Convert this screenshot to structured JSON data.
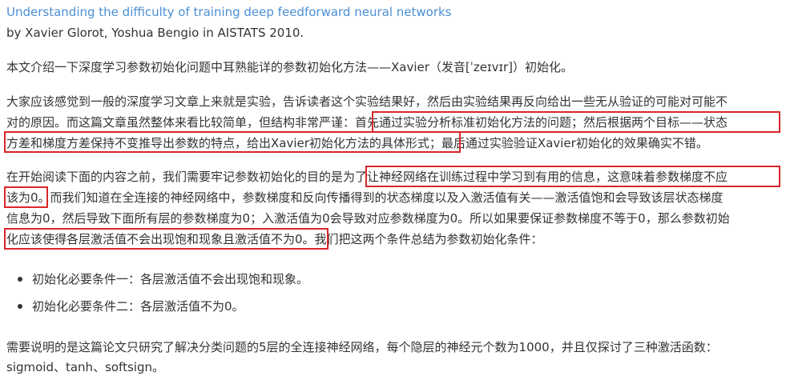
{
  "paper": {
    "title": "Understanding the difficulty of training deep feedforward neural networks",
    "byline": "by Xavier Glorot, Yoshua Bengio in AISTATS 2010."
  },
  "intro": "本文介绍一下深度学习参数初始化问题中耳熟能详的参数初始化方法——Xavier（发音[ˈzeɪvɪr]）初始化。",
  "para1": {
    "line1": "大家应该感觉到一般的深度学习文章上来就是实验，告诉读者这个实验结果好，然后由实验结果再反向给出一些无从验证的可能对可能不",
    "line2a": "对的原因。而这篇文章虽然整体来看比较简单，但结构非常严谨：",
    "line2b": "首先通过实验分析标准初始化方法的问题；然后根据两个目标——状态",
    "line3a": "方差和梯度方差保持不变推导出参数的特点，给出Xavier初始化方法的具体形式；",
    "line3b": "最后通过实验验证Xavier初始化的效果确实不错。"
  },
  "para2": {
    "line1a": "在开始阅读下面的内容之前，我们需要牢记参数初始化的目的是",
    "line1b": "为了让神经网络在训练过程中学习到有用的信息，这意味着参数梯度不应",
    "line2a": "该为0。",
    "line2b": "而我们知道在全连接的神经网络中，参数梯度和反向传播得到的状态梯度以及入激活值有关——激活值饱和会导致该层状态梯度",
    "line3": "信息为0，然后导致下面所有层的参数梯度为0；入激活值为0会导致对应参数梯度为0。所以如果要保证参数梯度不等于0，那么参数初始",
    "line4a": "化应该使得各层激活值不会出现饱和现象且激活值不为0。",
    "line4b": "我们把这两个条件总结为参数初始化条件："
  },
  "conditions": [
    "初始化必要条件一：各层激活值不会出现饱和现象。",
    "初始化必要条件二：各层激活值不为0。"
  ],
  "closing": {
    "line1": "需要说明的是这篇论文只研究了解决分类问题的5层的全连接神经网络，每个隐层的神经元个数为1000，并且仅探讨了三种激活函数：",
    "line2": "sigmoid、tanh、softsign。"
  },
  "colors": {
    "link": "#4c8fd4",
    "text": "#333333",
    "highlight_border": "#d9262c"
  }
}
